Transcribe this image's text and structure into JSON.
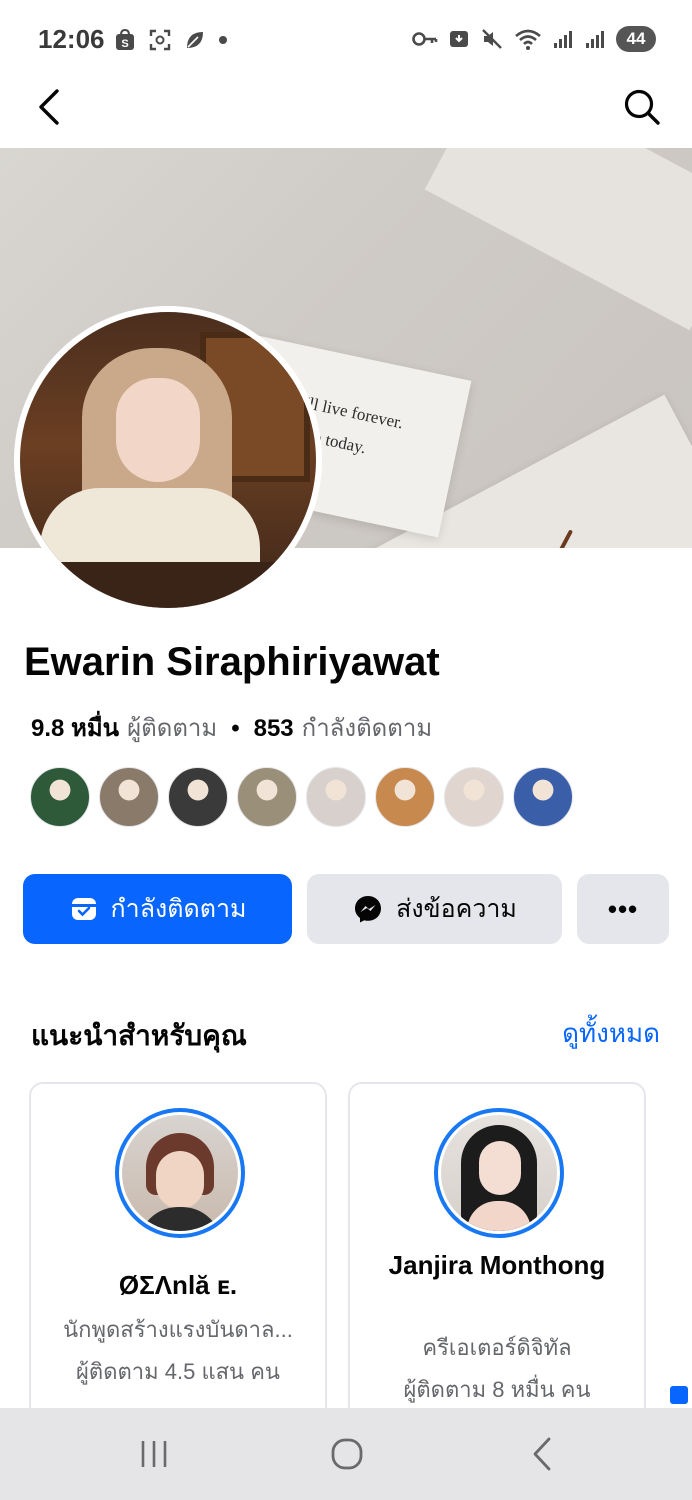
{
  "status_bar": {
    "time": "12:06",
    "battery_level": "44",
    "left_icons": [
      "shopee-icon",
      "scan-icon",
      "leaf-icon",
      "dot-icon"
    ],
    "right_icons": [
      "key-icon",
      "notification-icon",
      "mute-icon",
      "wifi-icon",
      "signal-icon",
      "signal-icon",
      "battery-icon"
    ]
  },
  "nav": {
    "back_icon": "chevron-left-icon",
    "search_icon": "search-icon"
  },
  "cover": {
    "card_line_1": "Dream as if you'll live forever.",
    "card_line_2": "Live as if you'll die today."
  },
  "profile": {
    "name": "Ewarin Siraphiriyawat",
    "followers_count": "9.8 หมื่น",
    "followers_label": "ผู้ติดตาม",
    "separator": "•",
    "following_count": "853",
    "following_label": "กำลังติดตาม"
  },
  "friends": [
    {
      "color": "#2f5a3a"
    },
    {
      "color": "#8a7a6a"
    },
    {
      "color": "#3a3a3a"
    },
    {
      "color": "#9a8f78"
    },
    {
      "color": "#d8d0cc"
    },
    {
      "color": "#c8894e"
    },
    {
      "color": "#e0d6cf"
    },
    {
      "color": "#3a5fa8"
    }
  ],
  "actions": {
    "following_label": "กำลังติดตาม",
    "message_label": "ส่งข้อความ",
    "more_label": "•••"
  },
  "suggestions": {
    "title": "แนะนำสำหรับคุณ",
    "see_all": "ดูทั้งหมด",
    "cards": [
      {
        "name": "ØΣΛnlă ᴇ.",
        "category": "นักพูดสร้างแรงบันดาล...",
        "followers": "ผู้ติดตาม 4.5 แสน คน"
      },
      {
        "name": "Janjira Monthong",
        "category": "ครีเอเตอร์ดิจิทัล",
        "followers": "ผู้ติดตาม 8 หมื่น คน"
      }
    ]
  },
  "colors": {
    "accent": "#0866ff",
    "secondary_text": "#65676b",
    "button_gray": "#e4e6eb"
  }
}
